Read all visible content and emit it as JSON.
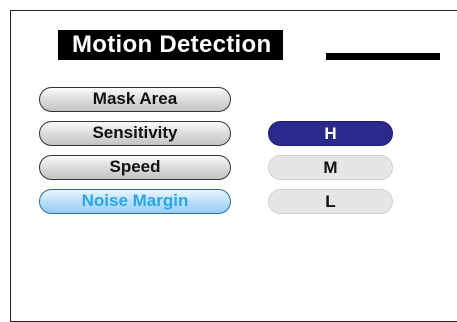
{
  "title": "Motion Detection",
  "menu": {
    "items": [
      {
        "label": "Mask Area"
      },
      {
        "label": "Sensitivity"
      },
      {
        "label": "Speed"
      },
      {
        "label": "Noise Margin"
      }
    ],
    "active": "Noise Margin"
  },
  "options": {
    "items": [
      {
        "label": "H"
      },
      {
        "label": "M"
      },
      {
        "label": "L"
      }
    ],
    "selected": "H"
  },
  "colors": {
    "selected_option": "#2b2a8c",
    "active_menu_text": "#2aa6e6",
    "active_menu_fill": "#b8defb"
  }
}
